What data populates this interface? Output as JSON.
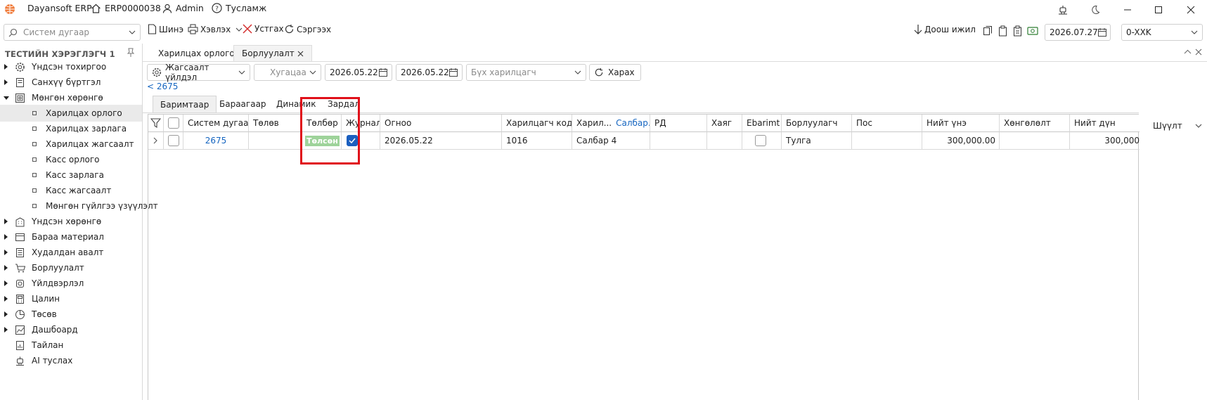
{
  "titlebar": {
    "app_name": "Dayansoft ERP",
    "company_code": "ERP0000038",
    "user": "Admin",
    "help": "Тусламж"
  },
  "toolbar": {
    "search_placeholder": "Систем дугаар",
    "new_label": "Шинэ",
    "print_label": "Хэвлэх",
    "delete_label": "Устгах",
    "refresh_label": "Сэргээх",
    "work_down_label": "Доош ижил",
    "date": "2026.07.27",
    "currency": "0-XXK"
  },
  "sidebar": {
    "title": "ТЕСТИЙН ХЭРЭГЛЭГЧ 1",
    "items": [
      {
        "label": "Үндсэн тохиргоо",
        "icon": "gear-icon"
      },
      {
        "label": "Санхүү бүртгэл",
        "icon": "ledger-icon"
      },
      {
        "label": "Мөнгөн хөрөнгө",
        "icon": "money-icon"
      },
      {
        "label": "Үндсэн хөрөнгө",
        "icon": "building-icon"
      },
      {
        "label": "Бараа материал",
        "icon": "box-icon"
      },
      {
        "label": "Худалдан авалт",
        "icon": "list-icon"
      },
      {
        "label": "Борлуулалт",
        "icon": "cart-icon"
      },
      {
        "label": "Үйлдвэрлэл",
        "icon": "factory-icon"
      },
      {
        "label": "Цалин",
        "icon": "calculator-icon"
      },
      {
        "label": "Төсөв",
        "icon": "pie-chart-icon"
      },
      {
        "label": "Дашбоард",
        "icon": "dashboard-icon"
      },
      {
        "label": "Тайлан",
        "icon": "report-icon"
      },
      {
        "label": "AI туслах",
        "icon": "robot-icon"
      }
    ],
    "subitems": [
      {
        "label": "Харилцах орлого"
      },
      {
        "label": "Харилцах зарлага"
      },
      {
        "label": "Харилцах жагсаалт"
      },
      {
        "label": "Касс орлого"
      },
      {
        "label": "Касс зарлага"
      },
      {
        "label": "Касс жагсаалт"
      },
      {
        "label": "Мөнгөн гүйлгээ үзүүлэлт"
      }
    ]
  },
  "doc_tabs": [
    {
      "label": "Харилцах орлого"
    },
    {
      "label": "Борлуулалт"
    }
  ],
  "filters": {
    "settings_label": "Жагсаалт үйлдэл",
    "period_placeholder": "Хугацаа",
    "date_from": "2026.05.22",
    "date_to": "2026.05.22",
    "partner_placeholder": "Бүх харилцагч",
    "view_label": "Харах"
  },
  "back_link": "< 2675",
  "inner_tabs": [
    {
      "label": "Баримтаар"
    },
    {
      "label": "Бараагаар"
    },
    {
      "label": "Динамик"
    },
    {
      "label": "Зардал"
    }
  ],
  "grid": {
    "headers": [
      "Систем дугаар",
      "Төлөв",
      "Төлбөр",
      "Журнал",
      "Огноо",
      "Харилцагч код",
      "Харил...",
      "Салбар...",
      "РД",
      "Хаяг",
      "Ebarimt",
      "Борлуулагч",
      "Пос",
      "Нийт үнэ",
      "Хөнгөлөлт",
      "Нийт дүн"
    ],
    "row": {
      "system_no": "2675",
      "status": "",
      "payment": "Төлсөн",
      "journal_checked": true,
      "date": "2026.05.22",
      "partner_code": "1016",
      "branch": "Салбар 4",
      "rd": "",
      "address": "",
      "seller": "Тулга",
      "pos": "",
      "total_price": "300,000.00",
      "discount": "",
      "total_amount": "300,000"
    }
  },
  "filter_panel": {
    "label": "Шүүлт"
  },
  "colors": {
    "highlight": "#e0101a",
    "paid_badge": "#9ed39a",
    "link": "#1565c0",
    "checkbox_on": "#1b5fbf"
  }
}
